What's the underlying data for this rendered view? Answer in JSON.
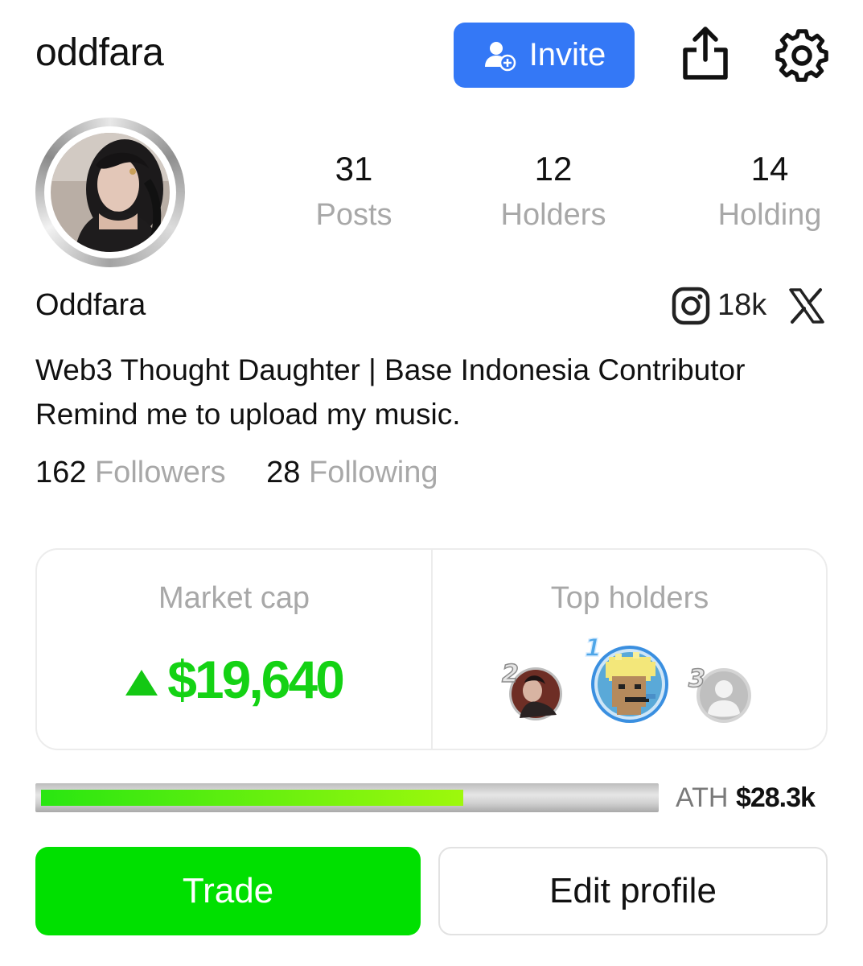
{
  "header": {
    "username": "oddfara",
    "invite_label": "Invite"
  },
  "stats": [
    {
      "value": "31",
      "label": "Posts"
    },
    {
      "value": "12",
      "label": "Holders"
    },
    {
      "value": "14",
      "label": "Holding"
    }
  ],
  "profile": {
    "display_name": "Oddfara",
    "instagram_count": "18k",
    "bio_line1": "Web3 Thought Daughter | Base Indonesia Contributor",
    "bio_line2": "Remind me to upload my music.",
    "followers_count": "162",
    "followers_label": "Followers",
    "following_count": "28",
    "following_label": "Following"
  },
  "market": {
    "label": "Market cap",
    "value": "$19,640",
    "trend": "up",
    "trend_color": "#14d214"
  },
  "top_holders": {
    "label": "Top holders",
    "holders": [
      {
        "rank": "2",
        "avatar": "photo-avatar"
      },
      {
        "rank": "1",
        "avatar": "pixel-art-avatar"
      },
      {
        "rank": "3",
        "avatar": "default-user-avatar"
      }
    ]
  },
  "progress": {
    "fraction": 0.69,
    "ath_label": "ATH",
    "ath_value": "$28.3k"
  },
  "actions": {
    "trade_label": "Trade",
    "edit_label": "Edit profile"
  },
  "colors": {
    "accent_blue": "#3478f6",
    "trade_green": "#00e000",
    "muted_gray": "#a8a8a8"
  }
}
